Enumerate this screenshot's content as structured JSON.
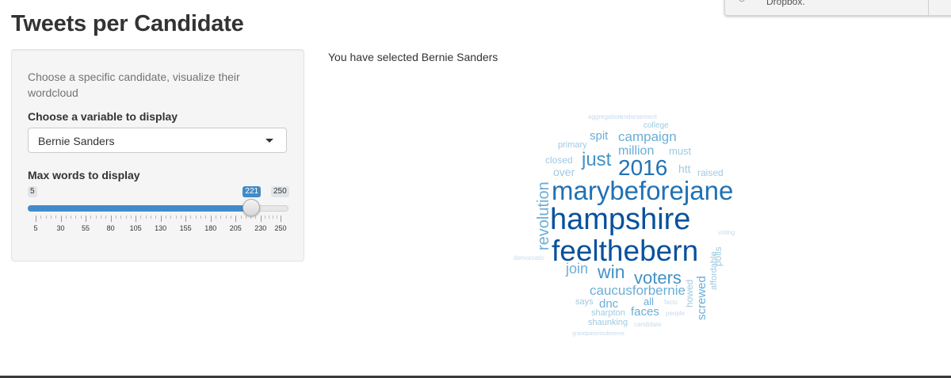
{
  "notification": {
    "text": "Dropbox."
  },
  "page": {
    "title": "Tweets per Candidate"
  },
  "sidebar": {
    "help_text": "Choose a specific candidate, visualize their wordcloud",
    "candidate_label": "Choose a variable to display",
    "candidate_selected": "Bernie Sanders",
    "slider_label": "Max words to display",
    "slider": {
      "min": 5,
      "max": 250,
      "value": 221,
      "min_label": "5",
      "max_label": "250",
      "value_label": "221",
      "ticks": [
        "5",
        "30",
        "55",
        "80",
        "105",
        "130",
        "155",
        "180",
        "205",
        "230",
        "250"
      ]
    }
  },
  "main": {
    "selected_text": "You have selected Bernie Sanders"
  },
  "wordcloud": {
    "colors": {
      "dark": "#08519c",
      "mid": "#2171b5",
      "light": "#4292c6",
      "pale": "#6baed6",
      "faint": "#9ecae1",
      "ghost": "#c6dbef"
    },
    "words": [
      "hampshire",
      "feelthebern",
      "marybeforejane",
      "2016",
      "revolution",
      "just",
      "voters",
      "win",
      "join",
      "caucusforbernie",
      "campaign",
      "million",
      "spit",
      "faces",
      "screwed",
      "polls",
      "dnc",
      "all",
      "says",
      "must",
      "htt",
      "raised",
      "over",
      "closed",
      "primary",
      "college",
      "shaunking",
      "sharpton",
      "howed",
      "affordable",
      "endorsement",
      "aggregation",
      "candidate",
      "democratic",
      "voting",
      "people",
      "facts",
      "grandparentsdeserve"
    ]
  }
}
